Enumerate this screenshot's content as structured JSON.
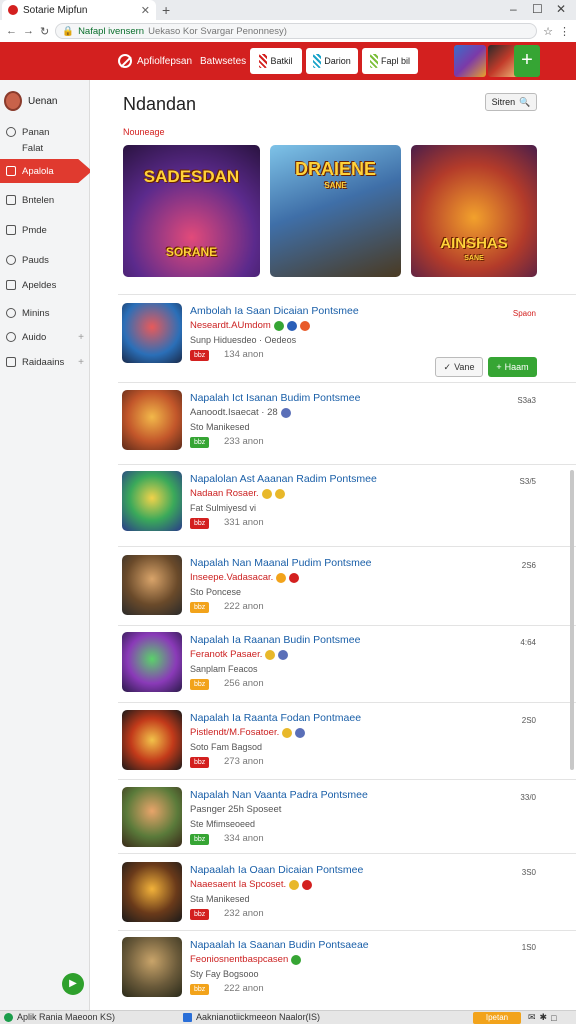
{
  "browser": {
    "tab_title": "Sotarie Mipfun",
    "new_tab": "+",
    "window_controls": [
      "–",
      "☐",
      "✕"
    ],
    "address_url": "Nafapl ivensern",
    "address_title": "Uekaso Kor Svargar Penonnesy)"
  },
  "topbar": {
    "nav1": "Apfiolfepsan",
    "nav2": "Batwsetes",
    "pills": [
      {
        "label": "Batkil",
        "color": "#d3201f"
      },
      {
        "label": "Darion",
        "color": "#1aa3c9"
      },
      {
        "label": "Fapl bil",
        "color": "#7bbf3a"
      }
    ],
    "plus_label": "+"
  },
  "sidebar": {
    "user": "Uenan",
    "items": [
      {
        "label": "Panan",
        "active": false
      },
      {
        "label": "Falat",
        "active": false
      },
      {
        "label": "Apalola",
        "active": true
      },
      {
        "label": "Bntelen",
        "active": false
      },
      {
        "label": "Pmde",
        "active": false
      },
      {
        "label": "Pauds",
        "active": false
      },
      {
        "label": "Apeldes",
        "active": false
      },
      {
        "label": "Minins",
        "active": false
      },
      {
        "label": "Auido",
        "active": false
      },
      {
        "label": "Raidaains",
        "active": false
      }
    ]
  },
  "main": {
    "title": "Ndandan",
    "search_label": "Sitren",
    "section_label": "Nouneage",
    "banners": [
      {
        "title": "SADESDAN",
        "sub": "SORANE"
      },
      {
        "title": "DRAIENE",
        "sub": "SANE"
      },
      {
        "title": "AINSHAS",
        "sub": "SANE"
      }
    ],
    "games": [
      {
        "title": "Ambolah Ia Saan Dicaian Pontsmee",
        "sub": "Neseardt.AUmdom",
        "note": "Sunp Hiduesdeo · Oedeos",
        "tag": "bbz",
        "tag_color": "#d3201f",
        "count": "134 anon",
        "right": "Spaon",
        "right_red": true,
        "actions": [
          "Vane",
          "Haam"
        ]
      },
      {
        "title": "Napalah Ict Isanan Budim Pontsmee",
        "sub": "Aanoodt.Isaecat · 28",
        "note": "Sto Manikesed",
        "tag": "bbz",
        "tag_color": "#36a534",
        "count": "233 anon",
        "right": "S3a3",
        "right_red": false
      },
      {
        "title": "Napalolan Ast Aaanan Radim Pontsmee",
        "sub": "Nadaan Rosaer.",
        "note": "Fat Sulmiyesd vi",
        "tag": "bbz",
        "tag_color": "#d3201f",
        "count": "331 anon",
        "right": "S3/5",
        "right_red": false
      },
      {
        "title": "Napalah Nan Maanal Pudim Pontsmee",
        "sub": "Inseepe.Vadasacar.",
        "note": "Sto Poncese",
        "tag": "bbz",
        "tag_color": "#f2a31b",
        "count": "222 anon",
        "right": "2S6",
        "right_red": false
      },
      {
        "title": "Napalah Ia Raanan Budin Pontsmee",
        "sub": "Feranotk Pasaer.",
        "note": "Sanplam Feacos",
        "tag": "bbz",
        "tag_color": "#f2a31b",
        "count": "256 anon",
        "right": "4:64",
        "right_red": false
      },
      {
        "title": "Napalah Ia Raanta Fodan Pontmaee",
        "sub": "Pistlendt/M.Fosatoer.",
        "note": "Soto Fam Bagsod",
        "tag": "bbz",
        "tag_color": "#d3201f",
        "count": "273 anon",
        "right": "2S0",
        "right_red": false
      },
      {
        "title": "Napalah Nan Vaanta Padra Pontsmee",
        "sub": "Pasnger 25h Sposeet",
        "note": "Ste Mfimseoeed",
        "tag": "bbz",
        "tag_color": "#36a534",
        "count": "334 anon",
        "right": "33/0",
        "right_red": false
      },
      {
        "title": "Napaalah Ia Oaan Dicaian Pontsmee",
        "sub": "Naaesaent Ia Spcoset.",
        "note": "Sta Manikesed",
        "tag": "bbz",
        "tag_color": "#d3201f",
        "count": "232 anon",
        "right": "3S0",
        "right_red": false
      },
      {
        "title": "Napaalah Ia Saanan Budin Pontsaeae",
        "sub": "Feoniosnentbaspcasen",
        "note": "Sty Fay Bogsooo",
        "tag": "bbz",
        "tag_color": "#f2a31b",
        "count": "222 anon",
        "right": "1S0",
        "right_red": false
      }
    ]
  },
  "taskbar": {
    "left": "Aplik Rania Maeoon KS)",
    "middle": "Aaknianotiickmeeon Naalor(IS)",
    "button": "Ipetan"
  }
}
